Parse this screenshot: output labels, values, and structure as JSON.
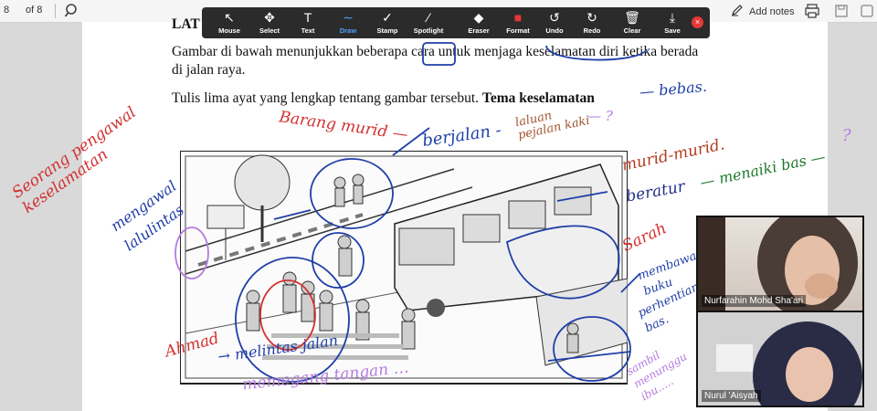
{
  "viewer": {
    "page_number": "8",
    "page_of": "of 8",
    "add_notes_label": "Add notes"
  },
  "annotation_toolbar": {
    "tools": [
      {
        "label": "Mouse",
        "icon": "cursor-icon",
        "glyph": "↖"
      },
      {
        "label": "Select",
        "icon": "move-icon",
        "glyph": "✥"
      },
      {
        "label": "Text",
        "icon": "text-icon",
        "glyph": "T"
      },
      {
        "label": "Draw",
        "icon": "draw-icon",
        "glyph": "∼",
        "active": true
      },
      {
        "label": "Stamp",
        "icon": "stamp-icon",
        "glyph": "✓"
      },
      {
        "label": "Spotlight",
        "icon": "spotlight-icon",
        "glyph": "⁄"
      },
      {
        "label": "Eraser",
        "icon": "eraser-icon",
        "glyph": "◆"
      },
      {
        "label": "Format",
        "icon": "format-icon",
        "glyph": "■"
      },
      {
        "label": "Undo",
        "icon": "undo-icon",
        "glyph": "↺"
      },
      {
        "label": "Redo",
        "icon": "redo-icon",
        "glyph": "↻"
      },
      {
        "label": "Clear",
        "icon": "trash-icon",
        "glyph": "🗑"
      },
      {
        "label": "Save",
        "icon": "save-icon",
        "glyph": "⤓"
      }
    ],
    "active_color": "#e53935"
  },
  "document": {
    "heading_fragment": "LAT",
    "paragraph1_a": "Gambar di bawah menunjukkan beberapa cara untuk menjaga keselamatan diri ketika berada",
    "paragraph1_b": "di jalan raya.",
    "paragraph2_text": "Tulis lima ayat yang lengkap tentang gambar tersebut. ",
    "paragraph2_bold": "Tema keselamatan"
  },
  "handwriting": {
    "bebas": "— bebas.",
    "barang_murid": "Barang murid —",
    "berjalan": "berjalan -",
    "laluan_pejalan_kaki": "laluan pejalan kaki",
    "q1": "— ?",
    "murid_murid": "murid-murid.",
    "beratur": "beratur",
    "menaiki_bas": "— menaiki bas —",
    "q2": "?",
    "seorang_pengawal": "Seorang pengawal keselamatan",
    "mengawal_lalulintas": "mengawal lalulintas",
    "sarah": "Sarah",
    "membawa_buku": "membawa buku",
    "perhentian_bas": "perhentian bas.",
    "sambil_menunggu": "sambil menunggu ibu.....",
    "ahmad": "Ahmad",
    "melintas_jalan": "→ melintas jalan",
    "memegang_tangan": "memegang tangan …"
  },
  "participants": [
    {
      "name": "Nurfarahin Mohd Sha'ari"
    },
    {
      "name": "Nurul 'Aisyah"
    }
  ],
  "colors": {
    "toolbar_bg": "#2b2b2b",
    "ink_red": "#d32f2f",
    "ink_blue": "#1f3fa8",
    "ink_darkblue": "#23308a",
    "ink_green": "#1e7a2e",
    "ink_purple": "#b57be0",
    "ink_brown": "#b33a1e"
  }
}
